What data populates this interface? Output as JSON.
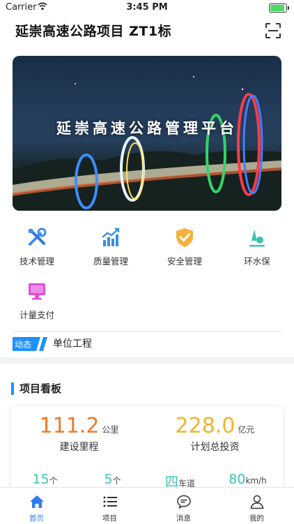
{
  "status_bar": {
    "carrier": "Carrier",
    "time": "3:45 PM"
  },
  "header": {
    "title": "延崇高速公路项目  ZT1标",
    "scan_icon": "scan-icon"
  },
  "banner": {
    "title": "延崇高速公路管理平台"
  },
  "menu": [
    {
      "label": "技术管理",
      "icon": "tools-icon",
      "color": "#3b8ef0"
    },
    {
      "label": "质量管理",
      "icon": "chart-up-icon",
      "color": "#3a8ee6"
    },
    {
      "label": "安全管理",
      "icon": "shield-check-icon",
      "color": "#f5b13c"
    },
    {
      "label": "环水保",
      "icon": "tree-icon",
      "color": "#3ec1b5"
    },
    {
      "label": "计量支付",
      "icon": "monitor-icon",
      "color": "#e04fd6"
    }
  ],
  "news": {
    "tag": "动态",
    "text": "单位工程"
  },
  "dashboard": {
    "title": "项目看板",
    "metrics": [
      {
        "value": "111.2",
        "unit": "公里",
        "caption": "建设里程",
        "color": "#f07a2a"
      },
      {
        "value": "228.0",
        "unit": "亿元",
        "caption": "计划总投资",
        "color": "#f5b42c"
      }
    ],
    "stats": [
      {
        "value": "15",
        "unit": "个",
        "color": "#3cc4ae"
      },
      {
        "value": "5",
        "unit": "个",
        "color": "#3cc4ae"
      },
      {
        "value": "四",
        "unit": "车道",
        "color": "#3cc4ae"
      },
      {
        "value": "80",
        "unit": "km/h",
        "color": "#3cc4ae"
      }
    ]
  },
  "tabbar": [
    {
      "label": "首页",
      "icon": "home-icon",
      "active": true
    },
    {
      "label": "项目",
      "icon": "list-icon",
      "active": false
    },
    {
      "label": "消息",
      "icon": "message-icon",
      "active": false
    },
    {
      "label": "我的",
      "icon": "user-icon",
      "active": false
    }
  ],
  "colors": {
    "accent": "#2f7df6",
    "section_bar": "#1e90ff"
  }
}
